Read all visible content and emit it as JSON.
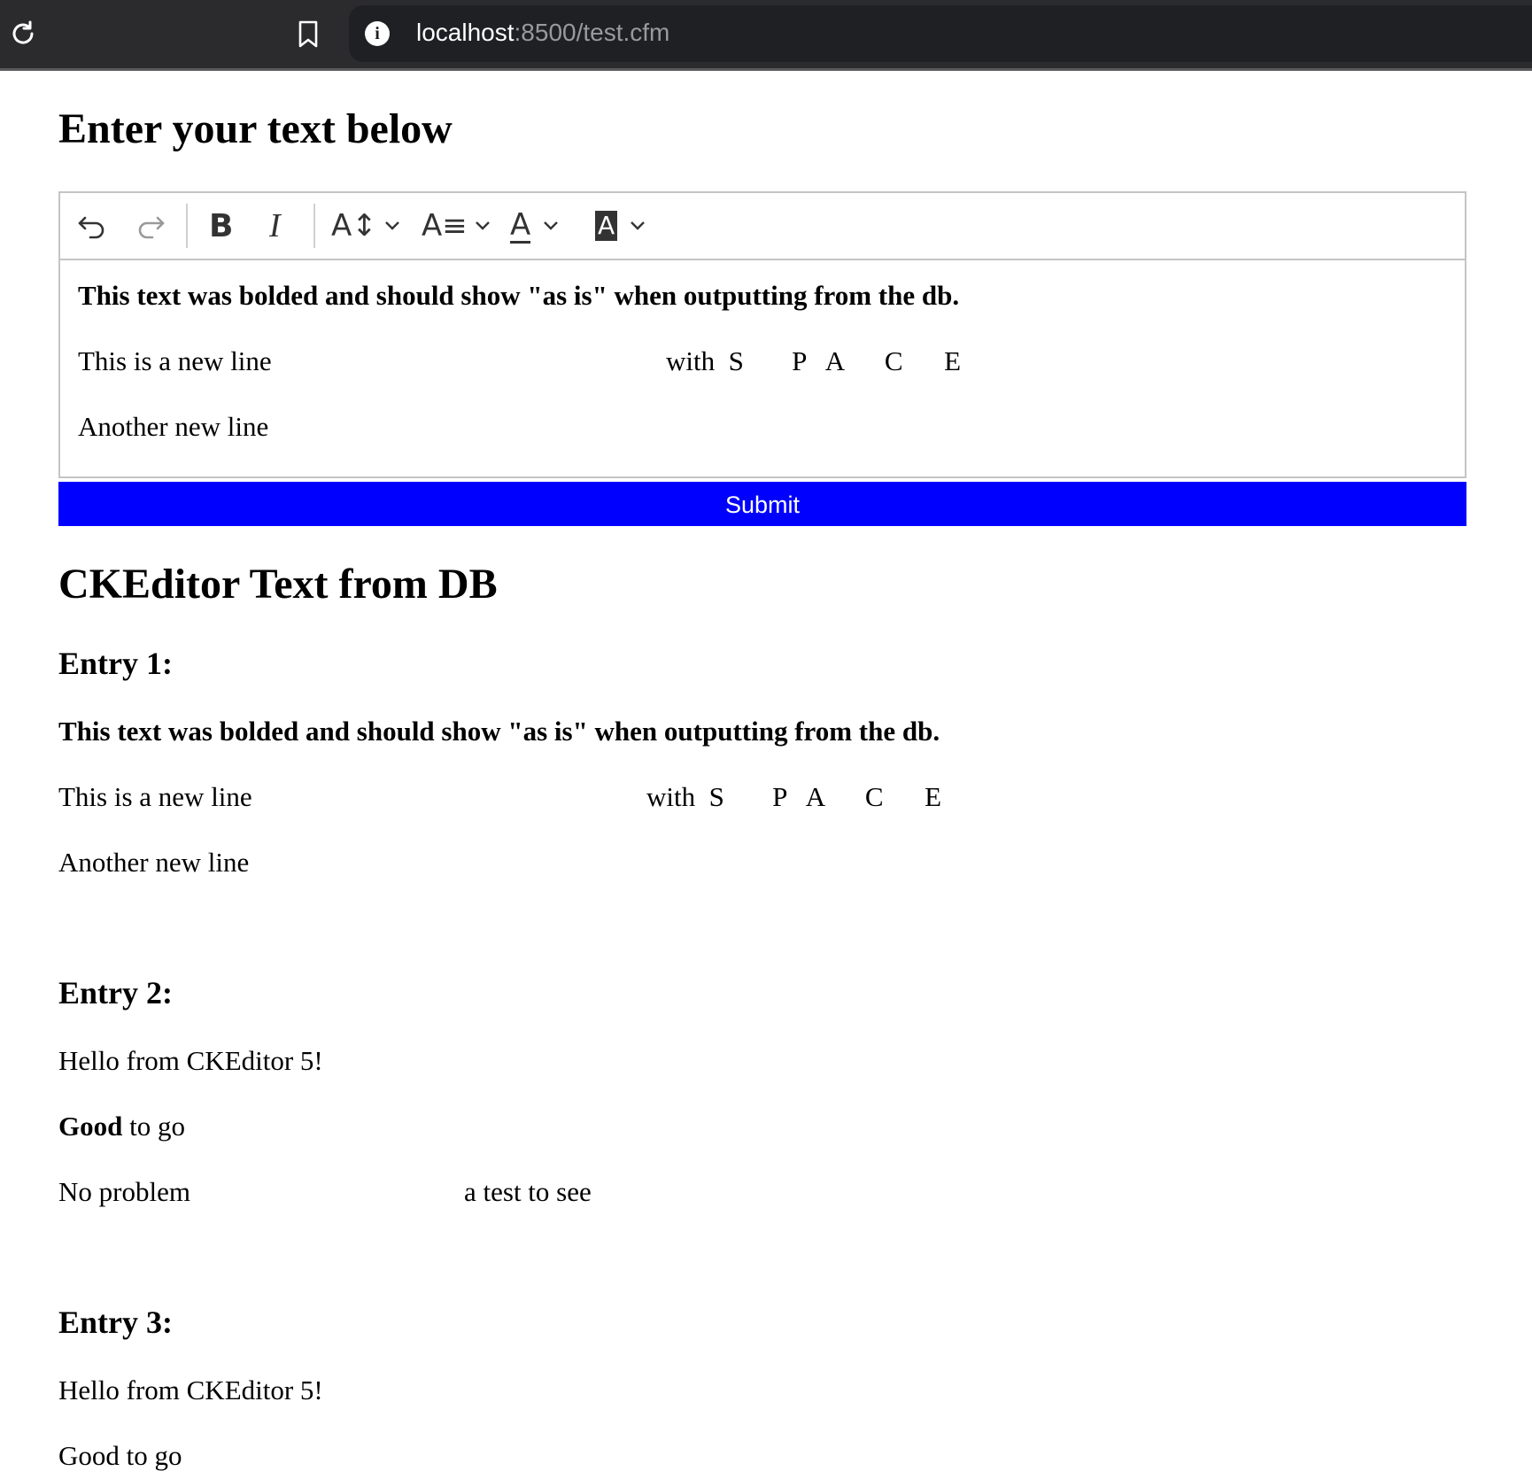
{
  "browser": {
    "url_host": "localhost",
    "url_rest": ":8500/test.cfm"
  },
  "form": {
    "heading": "Enter your text below",
    "toolbar": {
      "undo_icon": "undo-icon",
      "redo_icon": "redo-icon",
      "bold_label": "B",
      "italic_label": "I",
      "font_size_label": "A↕",
      "font_family_label": "A≡",
      "font_color_label": "A",
      "highlight_label": "A"
    },
    "editor_content": {
      "bold_line": "This text was bolded and should show \"as is\" when outputting from the db.",
      "line_2_start": "This is a new line",
      "line_2_end": "with  S       P   A      C      E",
      "line_3": "Another new line"
    },
    "submit_label": "Submit"
  },
  "db_section": {
    "heading": "CKEditor Text from DB",
    "entries": [
      {
        "title": "Entry 1:",
        "bold_line": "This text was bolded and should show \"as is\" when outputting from the db.",
        "line_2_start": "This is a new line",
        "line_2_end": "with  S       P   A      C      E",
        "line_3": "Another new line"
      },
      {
        "title": "Entry 2:",
        "line_1": "Hello from CKEditor 5!",
        "line_2_bold": "Good",
        "line_2_rest": " to go",
        "line_3_start": "No problem",
        "line_3_end": "a test to see"
      },
      {
        "title": "Entry 3:",
        "line_1": "Hello from CKEditor 5!",
        "line_2": "Good to go"
      }
    ]
  },
  "colors": {
    "submit_bg": "#0000ff",
    "browser_bar": "#2b2b2d"
  }
}
